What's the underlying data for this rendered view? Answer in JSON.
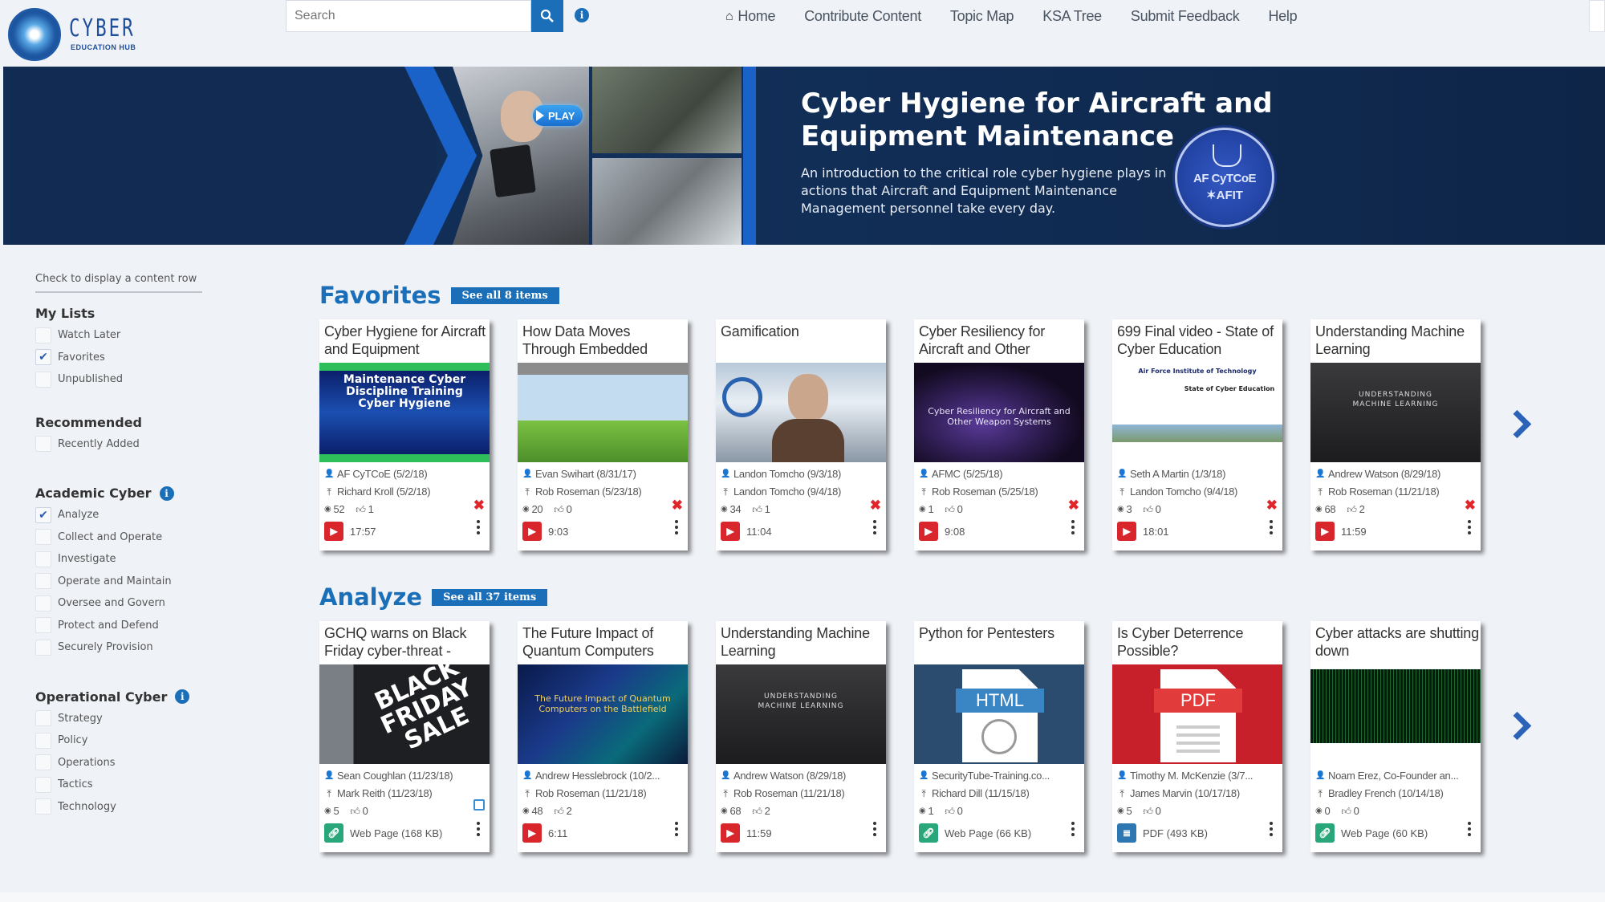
{
  "header": {
    "logo_text": "CYBER",
    "logo_subtext": "EDUCATION HUB",
    "search_placeholder": "Search",
    "nav": [
      {
        "label": "Home",
        "icon": "home-icon"
      },
      {
        "label": "Contribute Content"
      },
      {
        "label": "Topic Map"
      },
      {
        "label": "KSA Tree"
      },
      {
        "label": "Submit Feedback"
      },
      {
        "label": "Help"
      }
    ]
  },
  "banner": {
    "play_label": "PLAY",
    "title": "Cyber Hygiene for Aircraft and Equipment Maintenance",
    "description": "An introduction to the critical role cyber hygiene plays in actions that Aircraft and Equipment Maintenance Management personnel take every day.",
    "seal_line1": "AF CyTCoE",
    "seal_line2": "✶AFIT"
  },
  "sidebar": {
    "hint": "Check to display a content row",
    "groups": [
      {
        "title": "My Lists",
        "has_info": false,
        "items": [
          {
            "label": "Watch Later",
            "checked": false
          },
          {
            "label": "Favorites",
            "checked": true
          },
          {
            "label": "Unpublished",
            "checked": false
          }
        ]
      },
      {
        "title": "Recommended",
        "has_info": false,
        "items": [
          {
            "label": "Recently Added",
            "checked": false
          }
        ]
      },
      {
        "title": "Academic Cyber",
        "has_info": true,
        "items": [
          {
            "label": "Analyze",
            "checked": true
          },
          {
            "label": "Collect and Operate",
            "checked": false
          },
          {
            "label": "Investigate",
            "checked": false
          },
          {
            "label": "Operate and Maintain",
            "checked": false
          },
          {
            "label": "Oversee and Govern",
            "checked": false
          },
          {
            "label": "Protect and Defend",
            "checked": false
          },
          {
            "label": "Securely Provision",
            "checked": false
          }
        ]
      },
      {
        "title": "Operational Cyber",
        "has_info": true,
        "items": [
          {
            "label": "Strategy",
            "checked": false
          },
          {
            "label": "Policy",
            "checked": false
          },
          {
            "label": "Operations",
            "checked": false
          },
          {
            "label": "Tactics",
            "checked": false
          },
          {
            "label": "Technology",
            "checked": false
          }
        ]
      }
    ]
  },
  "sections": [
    {
      "title": "Favorites",
      "see_all": "See all 8 items",
      "cards": [
        {
          "title": "Cyber Hygiene for Aircraft and Equipment",
          "thumb": "hygiene",
          "thumb_text": "Maintenance Cyber Discipline Training Cyber Hygiene",
          "author": "AF CyTCoE (5/2/18)",
          "uploader": "Richard Kroll (5/2/18)",
          "views": "52",
          "likes": "1",
          "type": "video",
          "type_label": "17:57",
          "action": "remove"
        },
        {
          "title": "How Data Moves Through Embedded",
          "thumb": "datamoves",
          "thumb_text": "",
          "author": "Evan Swihart (8/31/17)",
          "uploader": "Rob Roseman (5/23/18)",
          "views": "20",
          "likes": "0",
          "type": "video",
          "type_label": "9:03",
          "action": "remove"
        },
        {
          "title": "Gamification",
          "thumb": "gamification",
          "thumb_text": "",
          "author": "Landon Tomcho (9/3/18)",
          "uploader": "Landon Tomcho (9/4/18)",
          "views": "34",
          "likes": "1",
          "type": "video",
          "type_label": "11:04",
          "action": "remove"
        },
        {
          "title": "Cyber Resiliency for Aircraft and Other",
          "thumb": "resiliency",
          "thumb_text": "Cyber Resiliency for Aircraft and Other Weapon Systems",
          "author": "AFMC (5/25/18)",
          "uploader": "Rob Roseman (5/25/18)",
          "views": "1",
          "likes": "0",
          "type": "video",
          "type_label": "9:08",
          "action": "remove"
        },
        {
          "title": "699 Final video - State of Cyber Education",
          "thumb": "afit",
          "thumb_text": "State of Cyber Education",
          "author": "Seth A Martin (1/3/18)",
          "uploader": "Landon Tomcho (9/4/18)",
          "views": "3",
          "likes": "0",
          "type": "video",
          "type_label": "18:01",
          "action": "remove"
        },
        {
          "title": "Understanding Machine Learning",
          "thumb": "ml",
          "thumb_text": "UNDERSTANDING MACHINE LEARNING",
          "author": "Andrew Watson (8/29/18)",
          "uploader": "Rob Roseman (11/21/18)",
          "views": "68",
          "likes": "2",
          "type": "video",
          "type_label": "11:59",
          "action": "remove"
        }
      ]
    },
    {
      "title": "Analyze",
      "see_all": "See all 37 items",
      "cards": [
        {
          "title": "GCHQ warns on Black Friday cyber-threat -",
          "thumb": "blackfriday",
          "thumb_text": "BLACK FRIDAY SALE",
          "author": "Sean Coughlan (11/23/18)",
          "uploader": "Mark Reith (11/23/18)",
          "views": "5",
          "likes": "0",
          "type": "web",
          "type_label": "Web Page (168 KB)",
          "action": "edit"
        },
        {
          "title": "The Future Impact of Quantum Computers",
          "thumb": "quantum",
          "thumb_text": "The Future Impact of Quantum Computers on the Battlefield",
          "author": "Andrew Hesslebrock (10/2...",
          "uploader": "Rob Roseman (11/21/18)",
          "views": "48",
          "likes": "2",
          "type": "video",
          "type_label": "6:11",
          "action": "none"
        },
        {
          "title": "Understanding Machine Learning",
          "thumb": "ml",
          "thumb_text": "UNDERSTANDING MACHINE LEARNING",
          "author": "Andrew Watson (8/29/18)",
          "uploader": "Rob Roseman (11/21/18)",
          "views": "68",
          "likes": "2",
          "type": "video",
          "type_label": "11:59",
          "action": "none"
        },
        {
          "title": "Python for Pentesters",
          "thumb": "html",
          "thumb_text": "HTML",
          "author": "SecurityTube-Training.co...",
          "uploader": "Richard Dill (11/15/18)",
          "views": "1",
          "likes": "0",
          "type": "web",
          "type_label": "Web Page (66 KB)",
          "action": "none"
        },
        {
          "title": "Is Cyber Deterrence Possible?",
          "thumb": "pdf",
          "thumb_text": "PDF",
          "author": "Timothy M. McKenzie (3/7...",
          "uploader": "James Marvin (10/17/18)",
          "views": "5",
          "likes": "0",
          "type": "pdf",
          "type_label": "PDF (493 KB)",
          "action": "none"
        },
        {
          "title": "Cyber attacks are shutting down",
          "thumb": "matrix",
          "thumb_text": "",
          "author": "Noam Erez, Co-Founder an...",
          "uploader": "Bradley French (10/14/18)",
          "views": "0",
          "likes": "0",
          "type": "web",
          "type_label": "Web Page (60 KB)",
          "action": "none"
        }
      ]
    }
  ],
  "colors": {
    "accent": "#1a6fb8",
    "remove": "#e0262b",
    "video": "#d8262c",
    "web": "#29a77a",
    "pdf": "#2d78b3",
    "banner_bg": "#112b52"
  }
}
